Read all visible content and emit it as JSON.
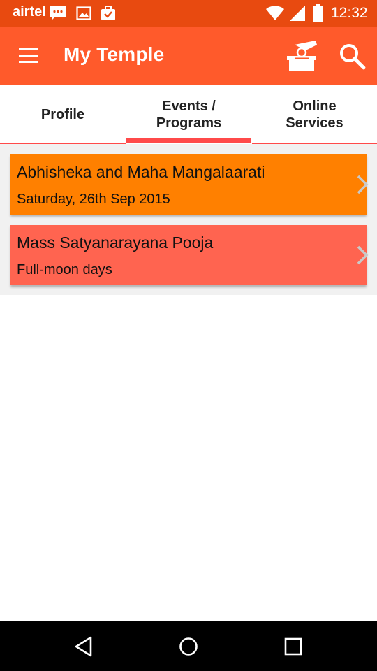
{
  "status_bar": {
    "carrier": "airtel",
    "time": "12:32",
    "icons": [
      "message-icon",
      "image-icon",
      "briefcase-icon",
      "wifi-icon",
      "signal-icon",
      "battery-icon"
    ]
  },
  "app_bar": {
    "title": "My Temple",
    "icons": [
      "menu-icon",
      "donation-icon",
      "search-icon"
    ]
  },
  "tabs": [
    {
      "line1": "Profile",
      "line2": "",
      "selected": false
    },
    {
      "line1": "Events /",
      "line2": "Programs",
      "selected": true
    },
    {
      "line1": "Online",
      "line2": "Services",
      "selected": false
    }
  ],
  "events": [
    {
      "title": "Abhisheka and Maha Mangalaarati",
      "subtitle": "Saturday, 26th Sep 2015",
      "color": "#ff8000"
    },
    {
      "title": "Mass Satyanarayana Pooja",
      "subtitle": "Full-moon days",
      "color": "#ff6450"
    }
  ],
  "colors": {
    "status_bar": "#e84a10",
    "app_bar": "#ff5a2b",
    "tab_indicator": "#ff4a4a",
    "nav_bar": "#000000"
  },
  "nav_bar": {
    "icons": [
      "back-icon",
      "home-icon",
      "recents-icon"
    ]
  }
}
